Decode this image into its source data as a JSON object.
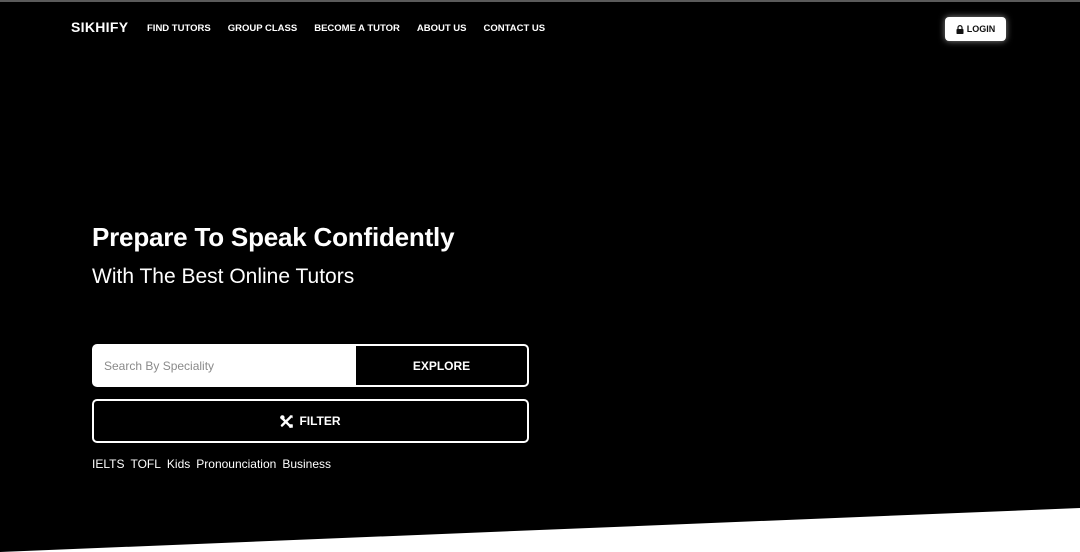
{
  "nav": {
    "brand": "SIKHIFY",
    "links": [
      "FIND TUTORS",
      "GROUP CLASS",
      "BECOME A TUTOR",
      "ABOUT US",
      "CONTACT US"
    ],
    "login_label": "LOGIN",
    "login_icon": "lock-icon"
  },
  "hero": {
    "title": "Prepare To Speak Confidently",
    "subtitle": "With The Best Online Tutors"
  },
  "search": {
    "placeholder": "Search By Speciality",
    "value": "",
    "button_label": "EXPLORE"
  },
  "filter": {
    "label": "FILTER",
    "icon": "tools-icon"
  },
  "tags": [
    "IELTS",
    "TOFL",
    "Kids",
    "Pronounciation",
    "Business"
  ],
  "colors": {
    "background": "#000000",
    "foreground": "#ffffff"
  }
}
